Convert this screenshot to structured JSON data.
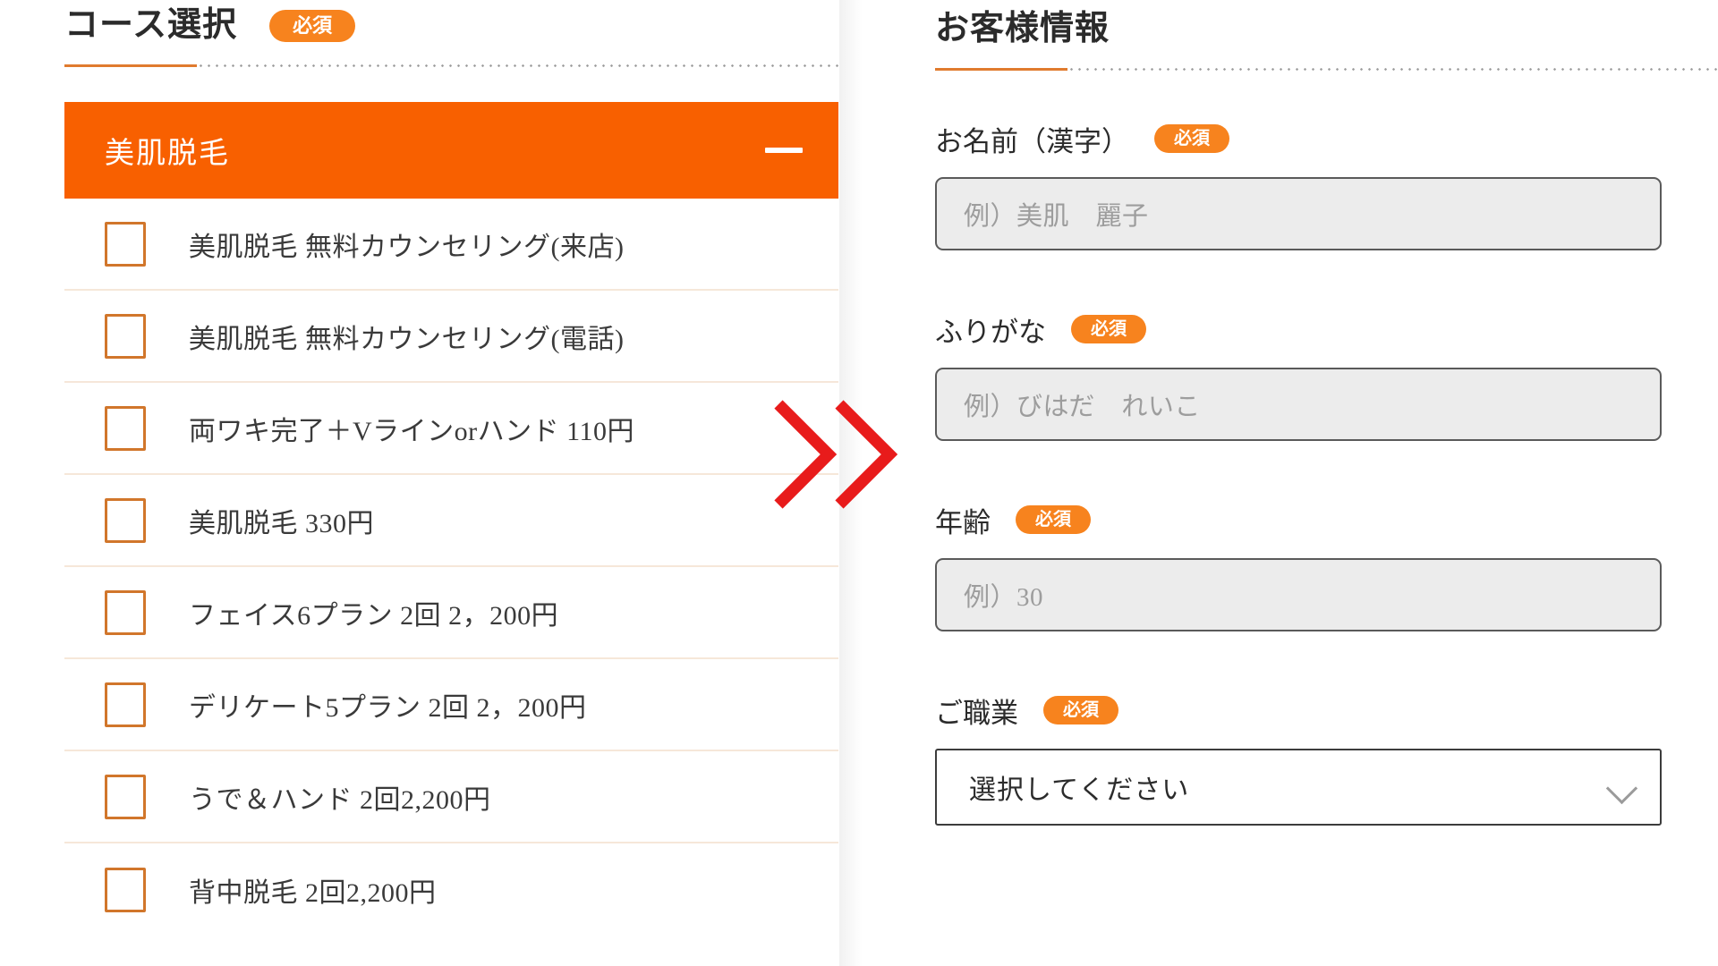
{
  "left": {
    "section_title": "コース選択",
    "required_badge": "必須",
    "accordion": {
      "title": "美肌脱毛",
      "collapse_icon": "minus-icon"
    },
    "courses": [
      {
        "label": "美肌脱毛 無料カウンセリング(来店)",
        "checked": false
      },
      {
        "label": "美肌脱毛 無料カウンセリング(電話)",
        "checked": false
      },
      {
        "label": "両ワキ完了＋Vラインorハンド 110円",
        "checked": false
      },
      {
        "label": "美肌脱毛 330円",
        "checked": false
      },
      {
        "label": "フェイス6プラン 2回 2，200円",
        "checked": false
      },
      {
        "label": "デリケート5プラン 2回 2，200円",
        "checked": false
      },
      {
        "label": "うで＆ハンド 2回2,200円",
        "checked": false
      },
      {
        "label": "背中脱毛 2回2,200円",
        "checked": false
      }
    ]
  },
  "right": {
    "section_title": "お客様情報",
    "fields": [
      {
        "label": "お名前（漢字）",
        "badge": "必須",
        "type": "text",
        "value": "",
        "placeholder": "例）美肌　麗子"
      },
      {
        "label": "ふりがな",
        "badge": "必須",
        "type": "text",
        "value": "",
        "placeholder": "例）びはだ　れいこ"
      },
      {
        "label": "年齢",
        "badge": "必須",
        "type": "text",
        "value": "",
        "placeholder": "例）30"
      },
      {
        "label": "ご職業",
        "badge": "必須",
        "type": "select",
        "selected": "選択してください",
        "chevron": "chevron-down-icon"
      }
    ]
  },
  "overlay": {
    "arrow": "double-chevron-right-arrow",
    "color": "#e81b1b"
  },
  "colors": {
    "accent_orange": "#f86000",
    "badge_orange": "#f7831e",
    "checkbox_border": "#d1762b",
    "row_divider": "#f6e7d9",
    "input_bg": "#ececec",
    "input_border": "#5a5a5a",
    "arrow_red": "#e81b1b"
  }
}
